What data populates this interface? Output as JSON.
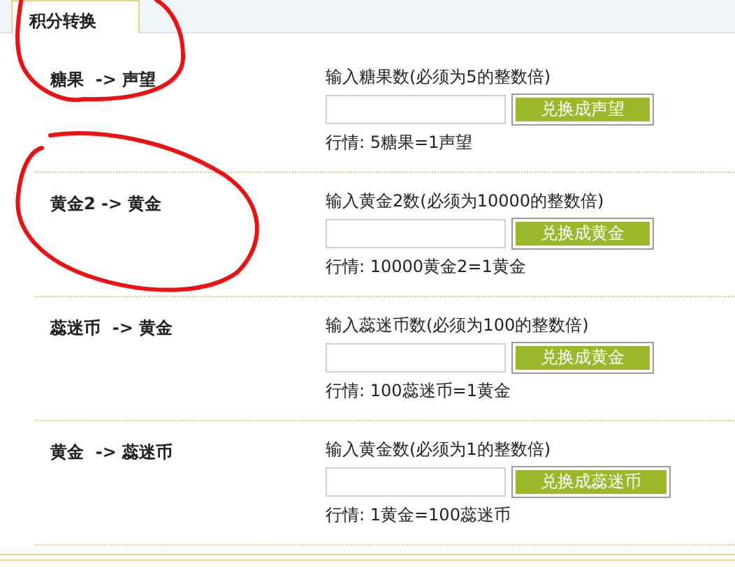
{
  "tabs": [
    {
      "label": "积分转换",
      "selected": true
    }
  ],
  "exchanges": [
    {
      "label": "糖果  -> 声望",
      "prompt": "输入糖果数(必须为5的整数倍)",
      "button": "兑换成声望",
      "rate": "行情: 5糖果=1声望"
    },
    {
      "label": "黄金2 -> 黄金",
      "prompt": "输入黄金2数(必须为10000的整数倍)",
      "button": "兑换成黄金",
      "rate": "行情: 10000黄金2=1黄金"
    },
    {
      "label": "蕊迷币  -> 黄金",
      "prompt": "输入蕊迷币数(必须为100的整数倍)",
      "button": "兑换成黄金",
      "rate": "行情: 100蕊迷币=1黄金"
    },
    {
      "label": "黄金  -> 蕊迷币",
      "prompt": "输入黄金数(必须为1的整数倍)",
      "button": "兑换成蕊迷币",
      "rate": "行情: 1黄金=100蕊迷币"
    }
  ]
}
